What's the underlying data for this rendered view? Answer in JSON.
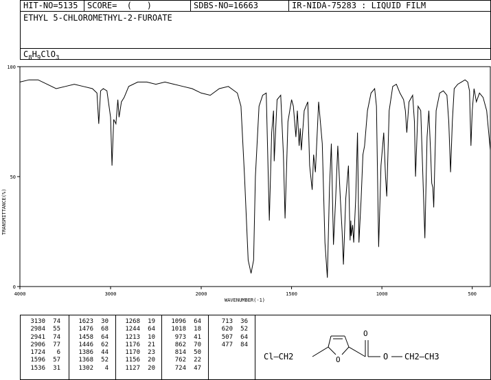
{
  "header": {
    "hit_no": "HIT-NO=5135",
    "score": "SCORE=  (   )",
    "sdbs_no": "SDBS-NO=16663",
    "ir_nida": "IR-NIDA-75283 : LIQUID FILM"
  },
  "compound": {
    "name": "ETHYL 5-CHLOROMETHYL-2-FUROATE",
    "formula": "C8H9ClO3"
  },
  "structure": {
    "left_group": "Cl—CH2",
    "ring_heteroatom": "O",
    "carbonyl_oxygen": "O",
    "ester_oxygen": "O",
    "right_group": "CH2—CH3"
  },
  "peak_table": [
    [
      [
        "3130",
        "74"
      ],
      [
        "2984",
        "55"
      ],
      [
        "2941",
        "74"
      ],
      [
        "2906",
        "77"
      ],
      [
        "1724",
        "6"
      ],
      [
        "1596",
        "57"
      ],
      [
        "1536",
        "31"
      ]
    ],
    [
      [
        "1623",
        "30"
      ],
      [
        "1476",
        "68"
      ],
      [
        "1458",
        "64"
      ],
      [
        "1446",
        "62"
      ],
      [
        "1386",
        "44"
      ],
      [
        "1368",
        "52"
      ],
      [
        "1302",
        "4"
      ]
    ],
    [
      [
        "1268",
        "19"
      ],
      [
        "1244",
        "64"
      ],
      [
        "1213",
        "10"
      ],
      [
        "1176",
        "21"
      ],
      [
        "1170",
        "23"
      ],
      [
        "1156",
        "20"
      ],
      [
        "1127",
        "20"
      ]
    ],
    [
      [
        "1096",
        "64"
      ],
      [
        "1018",
        "18"
      ],
      [
        "973",
        "41"
      ],
      [
        "862",
        "70"
      ],
      [
        "814",
        "50"
      ],
      [
        "762",
        "22"
      ],
      [
        "724",
        "47"
      ]
    ],
    [
      [
        "713",
        "36"
      ],
      [
        "620",
        "52"
      ],
      [
        "507",
        "64"
      ],
      [
        "477",
        "84"
      ]
    ]
  ],
  "chart_data": {
    "type": "line",
    "title": "",
    "xlabel": "WAVENUMBER(-1)",
    "ylabel": "TRANSMITTANCE(%)",
    "xlim": [
      4000,
      400
    ],
    "ylim": [
      0,
      100
    ],
    "x_ticks": [
      4000,
      3000,
      2000,
      1500,
      1000,
      500
    ],
    "y_ticks": [
      0,
      50,
      100
    ],
    "series": [
      {
        "name": "",
        "x": [
          4000,
          3900,
          3800,
          3700,
          3600,
          3500,
          3400,
          3300,
          3200,
          3150,
          3130,
          3110,
          3080,
          3040,
          3000,
          2984,
          2965,
          2941,
          2920,
          2906,
          2880,
          2850,
          2800,
          2700,
          2600,
          2500,
          2400,
          2300,
          2200,
          2100,
          2000,
          1950,
          1900,
          1850,
          1800,
          1780,
          1760,
          1740,
          1724,
          1710,
          1700,
          1680,
          1660,
          1640,
          1623,
          1610,
          1600,
          1596,
          1580,
          1560,
          1545,
          1536,
          1520,
          1500,
          1490,
          1476,
          1468,
          1458,
          1452,
          1446,
          1430,
          1410,
          1400,
          1386,
          1378,
          1368,
          1350,
          1330,
          1315,
          1302,
          1290,
          1280,
          1268,
          1256,
          1244,
          1230,
          1220,
          1213,
          1200,
          1185,
          1176,
          1172,
          1170,
          1162,
          1156,
          1145,
          1135,
          1127,
          1115,
          1105,
          1096,
          1080,
          1060,
          1040,
          1030,
          1018,
          1005,
          990,
          980,
          973,
          960,
          940,
          920,
          900,
          880,
          870,
          862,
          850,
          830,
          820,
          814,
          800,
          785,
          775,
          762,
          750,
          740,
          730,
          724,
          718,
          713,
          700,
          680,
          660,
          640,
          630,
          620,
          610,
          600,
          580,
          560,
          540,
          525,
          515,
          507,
          500,
          490,
          477,
          460,
          440,
          420,
          400
        ],
        "y": [
          93,
          94,
          94,
          92,
          90,
          91,
          92,
          91,
          90,
          88,
          74,
          89,
          90,
          89,
          77,
          55,
          76,
          74,
          85,
          77,
          84,
          86,
          91,
          93,
          93,
          92,
          93,
          92,
          91,
          90,
          88,
          87,
          90,
          91,
          88,
          82,
          50,
          12,
          6,
          12,
          50,
          82,
          87,
          88,
          30,
          70,
          80,
          57,
          85,
          87,
          60,
          31,
          75,
          85,
          82,
          68,
          80,
          64,
          72,
          62,
          80,
          84,
          55,
          44,
          60,
          52,
          84,
          65,
          20,
          4,
          45,
          65,
          19,
          40,
          64,
          40,
          25,
          10,
          40,
          55,
          21,
          30,
          23,
          28,
          20,
          40,
          70,
          20,
          40,
          60,
          64,
          80,
          88,
          90,
          82,
          18,
          55,
          70,
          50,
          41,
          80,
          91,
          92,
          88,
          85,
          80,
          70,
          84,
          87,
          75,
          50,
          82,
          80,
          55,
          22,
          68,
          80,
          60,
          47,
          45,
          36,
          80,
          88,
          89,
          87,
          75,
          52,
          75,
          90,
          92,
          93,
          94,
          93,
          89,
          64,
          80,
          90,
          84,
          88,
          86,
          80,
          62
        ]
      }
    ]
  }
}
